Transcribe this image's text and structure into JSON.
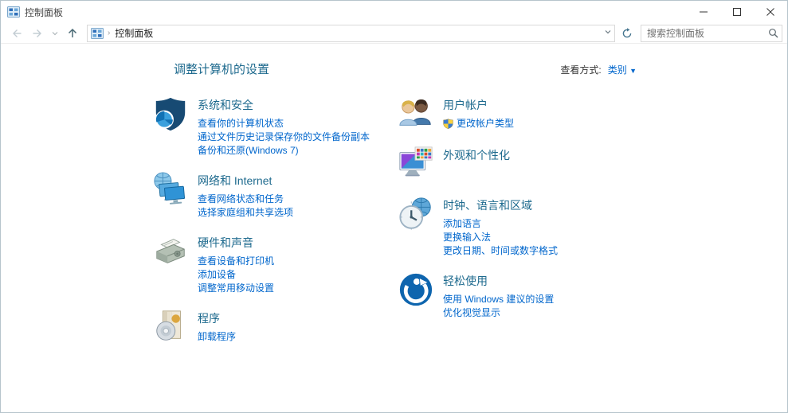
{
  "window": {
    "title": "控制面板",
    "controls": {
      "minimize": "minimize",
      "maximize": "maximize",
      "close": "close"
    }
  },
  "toolbar": {
    "breadcrumb": "控制面板",
    "breadcrumb_separator": "›",
    "search_placeholder": "搜索控制面板"
  },
  "header": {
    "title": "调整计算机的设置",
    "view_by_label": "查看方式:",
    "view_by_value": "类别",
    "view_by_caret": "▼"
  },
  "categories_left": [
    {
      "icon": "security-shield-icon",
      "title": "系统和安全",
      "links": [
        {
          "label": "查看你的计算机状态"
        },
        {
          "label": "通过文件历史记录保存你的文件备份副本"
        },
        {
          "label": "备份和还原(Windows 7)"
        }
      ]
    },
    {
      "icon": "network-internet-icon",
      "title": "网络和 Internet",
      "links": [
        {
          "label": "查看网络状态和任务"
        },
        {
          "label": "选择家庭组和共享选项"
        }
      ]
    },
    {
      "icon": "hardware-sound-icon",
      "title": "硬件和声音",
      "links": [
        {
          "label": "查看设备和打印机"
        },
        {
          "label": "添加设备"
        },
        {
          "label": "调整常用移动设置"
        }
      ]
    },
    {
      "icon": "programs-icon",
      "title": "程序",
      "links": [
        {
          "label": "卸载程序"
        }
      ]
    }
  ],
  "categories_right": [
    {
      "icon": "user-accounts-icon",
      "title": "用户帐户",
      "links": [
        {
          "label": "更改帐户类型",
          "uac_shield": true
        }
      ]
    },
    {
      "icon": "appearance-personalization-icon",
      "title": "外观和个性化",
      "links": []
    },
    {
      "icon": "clock-language-region-icon",
      "title": "时钟、语言和区域",
      "links": [
        {
          "label": "添加语言"
        },
        {
          "label": "更换输入法"
        },
        {
          "label": "更改日期、时间或数字格式"
        }
      ]
    },
    {
      "icon": "ease-of-access-icon",
      "title": "轻松使用",
      "links": [
        {
          "label": "使用 Windows 建议的设置"
        },
        {
          "label": "优化视觉显示"
        }
      ]
    }
  ],
  "colors": {
    "category_title": "#1e6a8e",
    "link_blue": "#0066cc",
    "ease_circle_blue": "#0e65ae",
    "shield_navy": "#174a73",
    "shield_pie_light": "#3aa0dd"
  }
}
